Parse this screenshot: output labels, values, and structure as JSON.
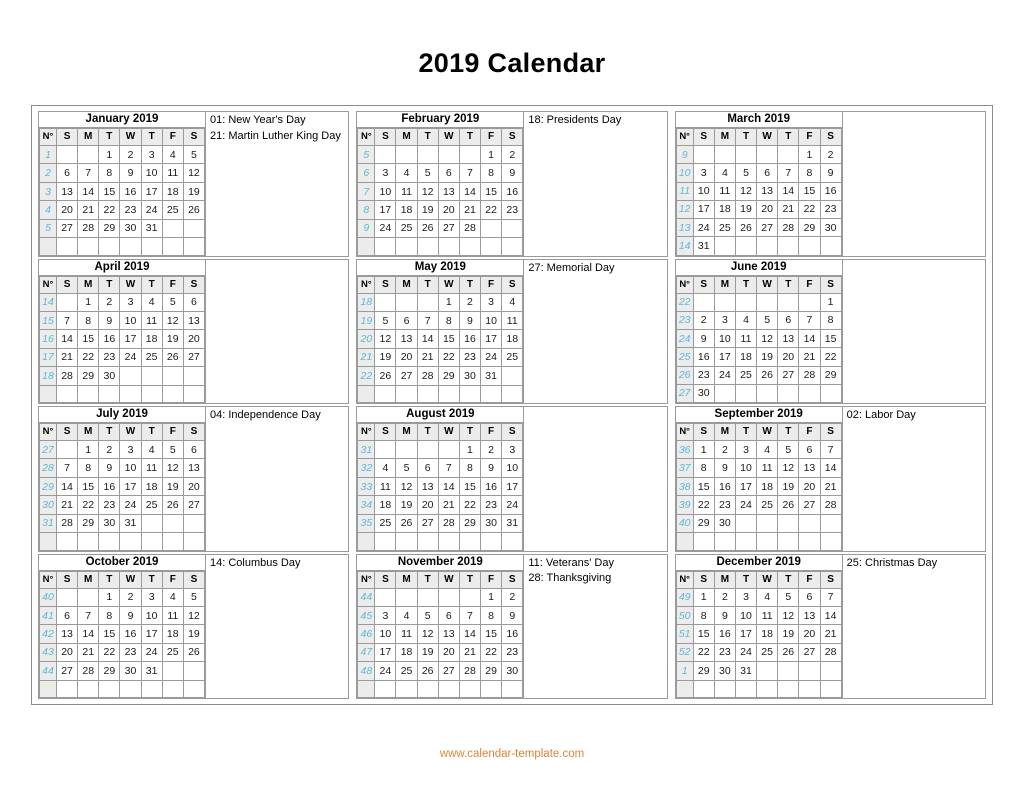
{
  "page": {
    "title": "2019 Calendar",
    "footer_url": "www.calendar-template.com"
  },
  "labels": {
    "week_header": "N°",
    "dow": [
      "S",
      "M",
      "T",
      "W",
      "T",
      "F",
      "S"
    ]
  },
  "colors": {
    "week_number": "#5bbad8",
    "holiday": "#e04a42",
    "header_background": "#ececec",
    "border": "#9a9a9a",
    "text": "#1a1a1a"
  },
  "months": [
    {
      "name": "January 2019",
      "weeks": [
        {
          "no": "1",
          "days": [
            "",
            "",
            "1",
            "2",
            "3",
            "4",
            "5"
          ]
        },
        {
          "no": "2",
          "days": [
            "6",
            "7",
            "8",
            "9",
            "10",
            "11",
            "12"
          ]
        },
        {
          "no": "3",
          "days": [
            "13",
            "14",
            "15",
            "16",
            "17",
            "18",
            "19"
          ]
        },
        {
          "no": "4",
          "days": [
            "20",
            "21",
            "22",
            "23",
            "24",
            "25",
            "26"
          ]
        },
        {
          "no": "5",
          "days": [
            "27",
            "28",
            "29",
            "30",
            "31",
            "",
            ""
          ]
        },
        {
          "no": "",
          "days": [
            "",
            "",
            "",
            "",
            "",
            "",
            ""
          ]
        }
      ],
      "holiday_days": [
        "1",
        "21"
      ],
      "holidays": [
        "01: New Year's Day",
        "21: Martin Luther King Day"
      ]
    },
    {
      "name": "February 2019",
      "weeks": [
        {
          "no": "5",
          "days": [
            "",
            "",
            "",
            "",
            "",
            "1",
            "2"
          ]
        },
        {
          "no": "6",
          "days": [
            "3",
            "4",
            "5",
            "6",
            "7",
            "8",
            "9"
          ]
        },
        {
          "no": "7",
          "days": [
            "10",
            "11",
            "12",
            "13",
            "14",
            "15",
            "16"
          ]
        },
        {
          "no": "8",
          "days": [
            "17",
            "18",
            "19",
            "20",
            "21",
            "22",
            "23"
          ]
        },
        {
          "no": "9",
          "days": [
            "24",
            "25",
            "26",
            "27",
            "28",
            "",
            ""
          ]
        },
        {
          "no": "",
          "days": [
            "",
            "",
            "",
            "",
            "",
            "",
            ""
          ]
        }
      ],
      "holiday_days": [
        "18"
      ],
      "holidays": [
        "18: Presidents Day"
      ]
    },
    {
      "name": "March 2019",
      "weeks": [
        {
          "no": "9",
          "days": [
            "",
            "",
            "",
            "",
            "",
            "1",
            "2"
          ]
        },
        {
          "no": "10",
          "days": [
            "3",
            "4",
            "5",
            "6",
            "7",
            "8",
            "9"
          ]
        },
        {
          "no": "11",
          "days": [
            "10",
            "11",
            "12",
            "13",
            "14",
            "15",
            "16"
          ]
        },
        {
          "no": "12",
          "days": [
            "17",
            "18",
            "19",
            "20",
            "21",
            "22",
            "23"
          ]
        },
        {
          "no": "13",
          "days": [
            "24",
            "25",
            "26",
            "27",
            "28",
            "29",
            "30"
          ]
        },
        {
          "no": "14",
          "days": [
            "31",
            "",
            "",
            "",
            "",
            "",
            ""
          ]
        }
      ],
      "holiday_days": [],
      "holidays": []
    },
    {
      "name": "April 2019",
      "weeks": [
        {
          "no": "14",
          "days": [
            "",
            "1",
            "2",
            "3",
            "4",
            "5",
            "6"
          ]
        },
        {
          "no": "15",
          "days": [
            "7",
            "8",
            "9",
            "10",
            "11",
            "12",
            "13"
          ]
        },
        {
          "no": "16",
          "days": [
            "14",
            "15",
            "16",
            "17",
            "18",
            "19",
            "20"
          ]
        },
        {
          "no": "17",
          "days": [
            "21",
            "22",
            "23",
            "24",
            "25",
            "26",
            "27"
          ]
        },
        {
          "no": "18",
          "days": [
            "28",
            "29",
            "30",
            "",
            "",
            "",
            ""
          ]
        },
        {
          "no": "",
          "days": [
            "",
            "",
            "",
            "",
            "",
            "",
            ""
          ]
        }
      ],
      "holiday_days": [],
      "holidays": []
    },
    {
      "name": "May 2019",
      "weeks": [
        {
          "no": "18",
          "days": [
            "",
            "",
            "",
            "1",
            "2",
            "3",
            "4"
          ]
        },
        {
          "no": "19",
          "days": [
            "5",
            "6",
            "7",
            "8",
            "9",
            "10",
            "11"
          ]
        },
        {
          "no": "20",
          "days": [
            "12",
            "13",
            "14",
            "15",
            "16",
            "17",
            "18"
          ]
        },
        {
          "no": "21",
          "days": [
            "19",
            "20",
            "21",
            "22",
            "23",
            "24",
            "25"
          ]
        },
        {
          "no": "22",
          "days": [
            "26",
            "27",
            "28",
            "29",
            "30",
            "31",
            ""
          ]
        },
        {
          "no": "",
          "days": [
            "",
            "",
            "",
            "",
            "",
            "",
            ""
          ]
        }
      ],
      "holiday_days": [
        "27"
      ],
      "holidays": [
        "27: Memorial Day"
      ]
    },
    {
      "name": "June 2019",
      "weeks": [
        {
          "no": "22",
          "days": [
            "",
            "",
            "",
            "",
            "",
            "",
            "1"
          ]
        },
        {
          "no": "23",
          "days": [
            "2",
            "3",
            "4",
            "5",
            "6",
            "7",
            "8"
          ]
        },
        {
          "no": "24",
          "days": [
            "9",
            "10",
            "11",
            "12",
            "13",
            "14",
            "15"
          ]
        },
        {
          "no": "25",
          "days": [
            "16",
            "17",
            "18",
            "19",
            "20",
            "21",
            "22"
          ]
        },
        {
          "no": "26",
          "days": [
            "23",
            "24",
            "25",
            "26",
            "27",
            "28",
            "29"
          ]
        },
        {
          "no": "27",
          "days": [
            "30",
            "",
            "",
            "",
            "",
            "",
            ""
          ]
        }
      ],
      "holiday_days": [],
      "holidays": []
    },
    {
      "name": "July 2019",
      "weeks": [
        {
          "no": "27",
          "days": [
            "",
            "1",
            "2",
            "3",
            "4",
            "5",
            "6"
          ]
        },
        {
          "no": "28",
          "days": [
            "7",
            "8",
            "9",
            "10",
            "11",
            "12",
            "13"
          ]
        },
        {
          "no": "29",
          "days": [
            "14",
            "15",
            "16",
            "17",
            "18",
            "19",
            "20"
          ]
        },
        {
          "no": "30",
          "days": [
            "21",
            "22",
            "23",
            "24",
            "25",
            "26",
            "27"
          ]
        },
        {
          "no": "31",
          "days": [
            "28",
            "29",
            "30",
            "31",
            "",
            "",
            ""
          ]
        },
        {
          "no": "",
          "days": [
            "",
            "",
            "",
            "",
            "",
            "",
            ""
          ]
        }
      ],
      "holiday_days": [
        "4"
      ],
      "holidays": [
        "04: Independence Day"
      ]
    },
    {
      "name": "August 2019",
      "weeks": [
        {
          "no": "31",
          "days": [
            "",
            "",
            "",
            "",
            "1",
            "2",
            "3"
          ]
        },
        {
          "no": "32",
          "days": [
            "4",
            "5",
            "6",
            "7",
            "8",
            "9",
            "10"
          ]
        },
        {
          "no": "33",
          "days": [
            "11",
            "12",
            "13",
            "14",
            "15",
            "16",
            "17"
          ]
        },
        {
          "no": "34",
          "days": [
            "18",
            "19",
            "20",
            "21",
            "22",
            "23",
            "24"
          ]
        },
        {
          "no": "35",
          "days": [
            "25",
            "26",
            "27",
            "28",
            "29",
            "30",
            "31"
          ]
        },
        {
          "no": "",
          "days": [
            "",
            "",
            "",
            "",
            "",
            "",
            ""
          ]
        }
      ],
      "holiday_days": [],
      "holidays": []
    },
    {
      "name": "September 2019",
      "weeks": [
        {
          "no": "36",
          "days": [
            "1",
            "2",
            "3",
            "4",
            "5",
            "6",
            "7"
          ]
        },
        {
          "no": "37",
          "days": [
            "8",
            "9",
            "10",
            "11",
            "12",
            "13",
            "14"
          ]
        },
        {
          "no": "38",
          "days": [
            "15",
            "16",
            "17",
            "18",
            "19",
            "20",
            "21"
          ]
        },
        {
          "no": "39",
          "days": [
            "22",
            "23",
            "24",
            "25",
            "26",
            "27",
            "28"
          ]
        },
        {
          "no": "40",
          "days": [
            "29",
            "30",
            "",
            "",
            "",
            "",
            ""
          ]
        },
        {
          "no": "",
          "days": [
            "",
            "",
            "",
            "",
            "",
            "",
            ""
          ]
        }
      ],
      "holiday_days": [
        "2"
      ],
      "holidays": [
        "02: Labor Day"
      ]
    },
    {
      "name": "October 2019",
      "weeks": [
        {
          "no": "40",
          "days": [
            "",
            "",
            "1",
            "2",
            "3",
            "4",
            "5"
          ]
        },
        {
          "no": "41",
          "days": [
            "6",
            "7",
            "8",
            "9",
            "10",
            "11",
            "12"
          ]
        },
        {
          "no": "42",
          "days": [
            "13",
            "14",
            "15",
            "16",
            "17",
            "18",
            "19"
          ]
        },
        {
          "no": "43",
          "days": [
            "20",
            "21",
            "22",
            "23",
            "24",
            "25",
            "26"
          ]
        },
        {
          "no": "44",
          "days": [
            "27",
            "28",
            "29",
            "30",
            "31",
            "",
            ""
          ]
        },
        {
          "no": "",
          "days": [
            "",
            "",
            "",
            "",
            "",
            "",
            ""
          ]
        }
      ],
      "holiday_days": [
        "14"
      ],
      "holidays": [
        "14: Columbus Day"
      ]
    },
    {
      "name": "November 2019",
      "weeks": [
        {
          "no": "44",
          "days": [
            "",
            "",
            "",
            "",
            "",
            "1",
            "2"
          ]
        },
        {
          "no": "45",
          "days": [
            "3",
            "4",
            "5",
            "6",
            "7",
            "8",
            "9"
          ]
        },
        {
          "no": "46",
          "days": [
            "10",
            "11",
            "12",
            "13",
            "14",
            "15",
            "16"
          ]
        },
        {
          "no": "47",
          "days": [
            "17",
            "18",
            "19",
            "20",
            "21",
            "22",
            "23"
          ]
        },
        {
          "no": "48",
          "days": [
            "24",
            "25",
            "26",
            "27",
            "28",
            "29",
            "30"
          ]
        },
        {
          "no": "",
          "days": [
            "",
            "",
            "",
            "",
            "",
            "",
            ""
          ]
        }
      ],
      "holiday_days": [
        "11",
        "28"
      ],
      "holidays": [
        "11: Veterans' Day",
        "28: Thanksgiving"
      ]
    },
    {
      "name": "December 2019",
      "weeks": [
        {
          "no": "49",
          "days": [
            "1",
            "2",
            "3",
            "4",
            "5",
            "6",
            "7"
          ]
        },
        {
          "no": "50",
          "days": [
            "8",
            "9",
            "10",
            "11",
            "12",
            "13",
            "14"
          ]
        },
        {
          "no": "51",
          "days": [
            "15",
            "16",
            "17",
            "18",
            "19",
            "20",
            "21"
          ]
        },
        {
          "no": "52",
          "days": [
            "22",
            "23",
            "24",
            "25",
            "26",
            "27",
            "28"
          ]
        },
        {
          "no": "1",
          "days": [
            "29",
            "30",
            "31",
            "",
            "",
            "",
            ""
          ]
        },
        {
          "no": "",
          "days": [
            "",
            "",
            "",
            "",
            "",
            "",
            ""
          ]
        }
      ],
      "holiday_days": [
        "25"
      ],
      "holidays": [
        "25: Christmas Day"
      ]
    }
  ]
}
